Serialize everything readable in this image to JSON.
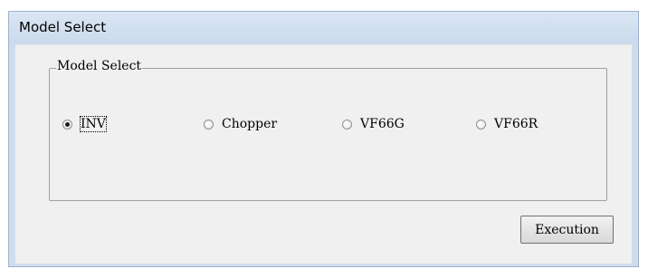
{
  "window": {
    "title": "Model Select"
  },
  "group": {
    "label": "Model Select",
    "options": [
      {
        "label": "INV",
        "checked": true
      },
      {
        "label": "Chopper",
        "checked": false
      },
      {
        "label": "VF66G",
        "checked": false
      },
      {
        "label": "VF66R",
        "checked": false
      }
    ]
  },
  "buttons": {
    "execution_label": "Execution"
  },
  "colors": {
    "frame": "#cfdcec",
    "client": "#f0f0f0"
  }
}
